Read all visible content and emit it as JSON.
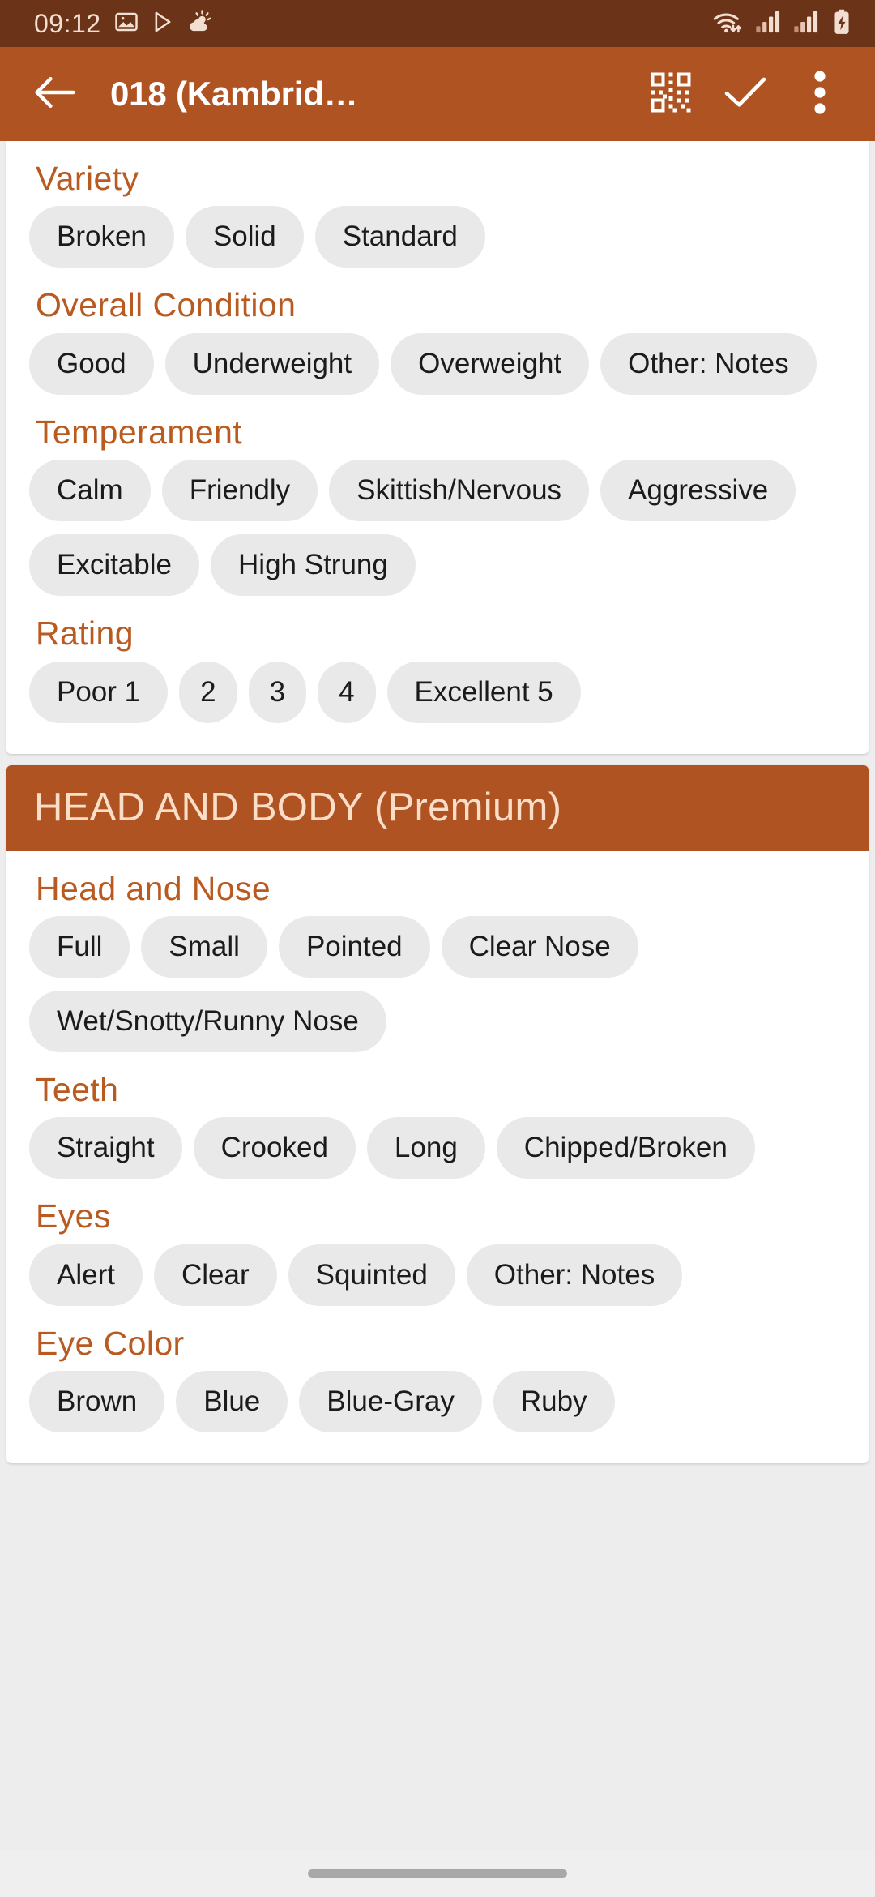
{
  "status_bar": {
    "clock": "09:12",
    "left_icons": [
      "image-icon",
      "play-store-icon",
      "weather-icon"
    ],
    "right_icons": [
      "wifi-icon",
      "signal-sim1-icon",
      "signal-sim2-icon",
      "battery-charging-icon"
    ],
    "background_color": "#6B3419",
    "foreground_color": "#F3DFD2"
  },
  "app_bar": {
    "title": "018 (Kambrid…",
    "back_icon": "arrow-left-icon",
    "actions": [
      {
        "name": "qr-code-icon",
        "label": "QR Code"
      },
      {
        "name": "check-icon",
        "label": "Save"
      },
      {
        "name": "overflow-menu-icon",
        "label": "More options"
      }
    ],
    "background_color": "#B05323",
    "text_color": "#FFFFFF"
  },
  "theme": {
    "accent": "#B05323",
    "group_title_color": "#B95A20",
    "banner_text_color": "#FBDEC8",
    "chip_background": "#E9E9E9",
    "chip_text": "#1B1B1B",
    "page_background": "#EDEDED",
    "card_background": "#FFFFFF"
  },
  "cards": [
    {
      "name": "general-card",
      "banner": null,
      "groups": [
        {
          "title": "Variety",
          "chips": [
            "Broken",
            "Solid",
            "Standard"
          ]
        },
        {
          "title": "Overall Condition",
          "chips": [
            "Good",
            "Underweight",
            "Overweight",
            "Other: Notes"
          ]
        },
        {
          "title": "Temperament",
          "chips": [
            "Calm",
            "Friendly",
            "Skittish/Nervous",
            "Aggressive",
            "Excitable",
            "High Strung"
          ]
        },
        {
          "title": "Rating",
          "chips": [
            "Poor 1",
            "2",
            "3",
            "4",
            "Excellent 5"
          ]
        }
      ]
    },
    {
      "name": "head-and-body-card",
      "banner": "HEAD AND BODY (Premium)",
      "groups": [
        {
          "title": "Head and Nose",
          "chips": [
            "Full",
            "Small",
            "Pointed",
            "Clear Nose",
            "Wet/Snotty/Runny Nose"
          ]
        },
        {
          "title": "Teeth",
          "chips": [
            "Straight",
            "Crooked",
            "Long",
            "Chipped/Broken"
          ]
        },
        {
          "title": "Eyes",
          "chips": [
            "Alert",
            "Clear",
            "Squinted",
            "Other: Notes"
          ]
        },
        {
          "title": "Eye Color",
          "chips": [
            "Brown",
            "Blue",
            "Blue-Gray",
            "Ruby"
          ]
        }
      ]
    }
  ],
  "nav_bar": {
    "gesture_pill": "home-gesture-pill"
  }
}
